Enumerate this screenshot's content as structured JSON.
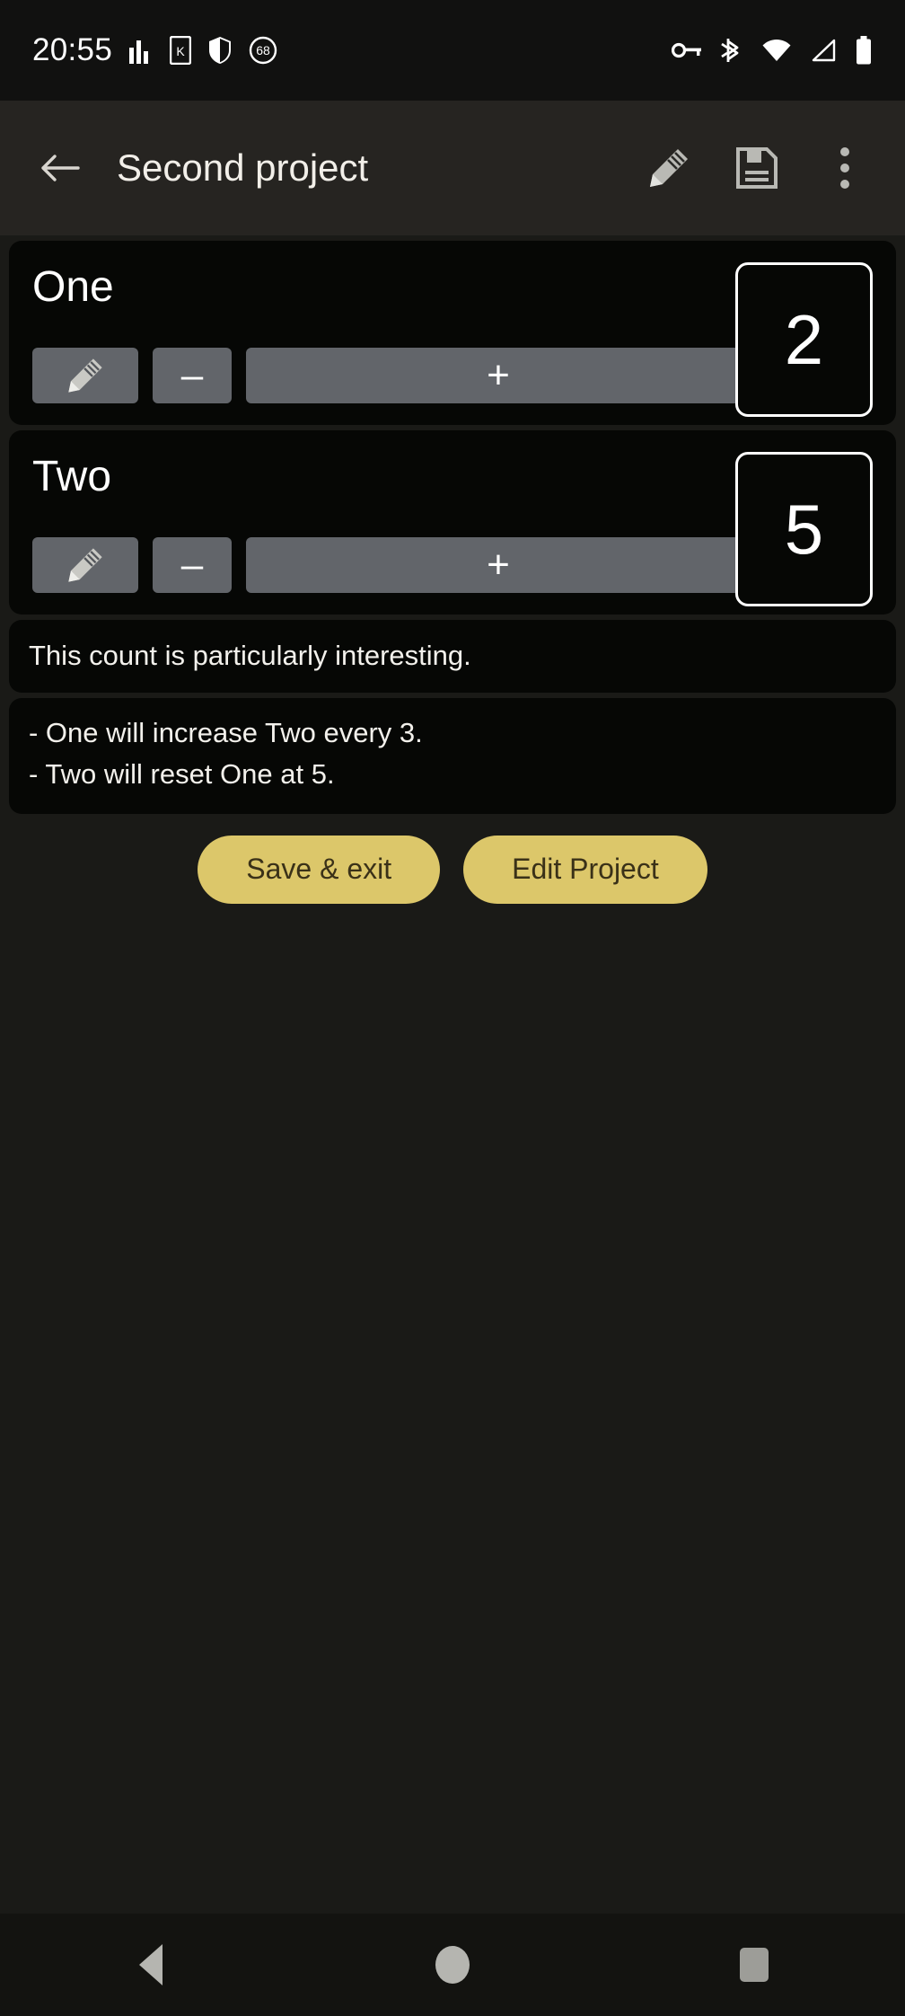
{
  "status_bar": {
    "time": "20:55",
    "left_icons": [
      "signal-bars-icon",
      "sim-k-icon",
      "shield-icon",
      "battery-saver-68-icon"
    ],
    "battery_saver_level": "68",
    "right_icons": [
      "vpn-key-icon",
      "bluetooth-icon",
      "wifi-icon",
      "cell-signal-icon",
      "battery-icon"
    ]
  },
  "app_bar": {
    "back_icon": "arrow-left-icon",
    "title": "Second project",
    "actions": [
      {
        "icon": "pencil-icon",
        "name": "edit-mode-button"
      },
      {
        "icon": "floppy-save-icon",
        "name": "save-button"
      },
      {
        "icon": "overflow-menu-icon",
        "name": "more-options-button"
      }
    ]
  },
  "counters": [
    {
      "name": "One",
      "count": "2",
      "edit_icon": "pencil-icon",
      "decrement_label": "–",
      "increment_label": "+"
    },
    {
      "name": "Two",
      "count": "5",
      "edit_icon": "pencil-icon",
      "decrement_label": "–",
      "increment_label": "+"
    }
  ],
  "notes": {
    "comment": "This count is particularly interesting.",
    "rules": [
      "- One will increase Two every 3.",
      "- Two will reset One at 5."
    ]
  },
  "actions": {
    "save_exit_label": "Save & exit",
    "edit_project_label": "Edit Project"
  },
  "nav_bar": {
    "back": "nav-back-icon",
    "home": "nav-home-icon",
    "recents": "nav-recents-icon"
  },
  "colors": {
    "accent": "#dcc76a",
    "accent_text": "#3a3118",
    "app_bar_bg": "#262421",
    "card_bg": "#060705",
    "page_bg": "#1a1a17",
    "button_gray": "#62656a"
  }
}
